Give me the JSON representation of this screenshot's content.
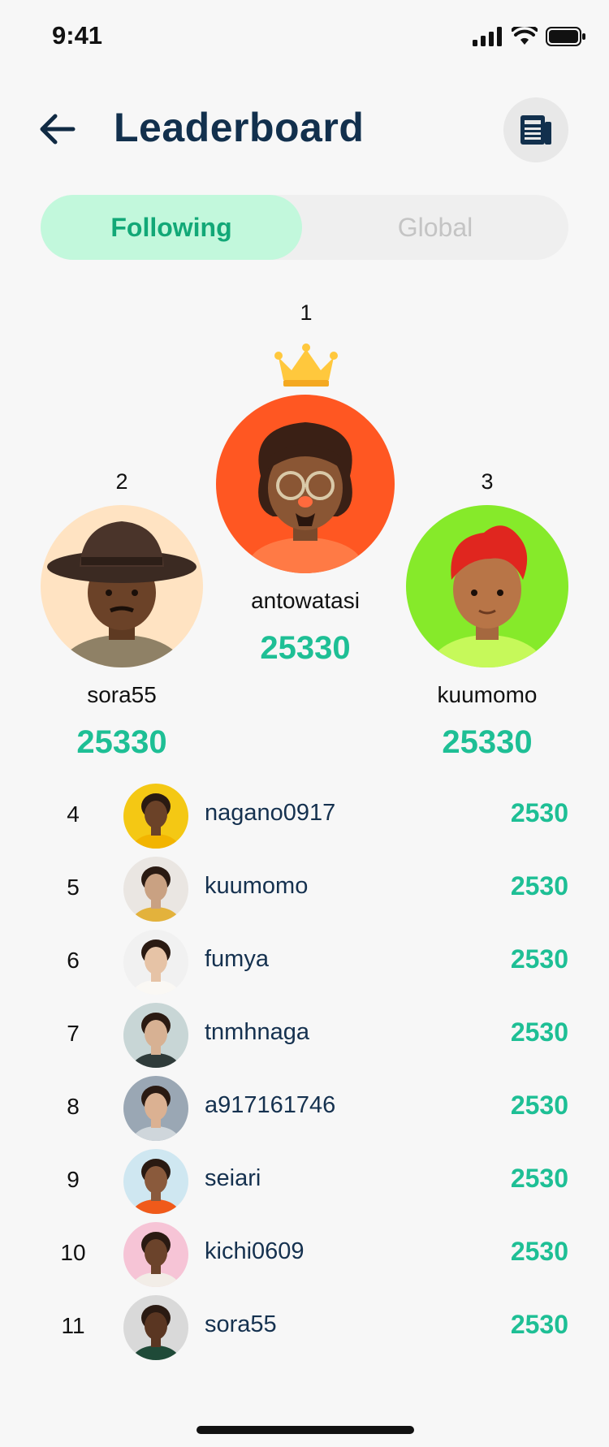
{
  "status_bar": {
    "time": "9:41"
  },
  "header": {
    "title": "Leaderboard"
  },
  "tabs": [
    {
      "label": "Following",
      "active": true
    },
    {
      "label": "Global",
      "active": false
    }
  ],
  "podium": {
    "first": {
      "rank": "1",
      "name": "antowatasi",
      "score": "25330",
      "bg": "#ff5722"
    },
    "second": {
      "rank": "2",
      "name": "sora55",
      "score": "25330",
      "bg": "#ffe3c2"
    },
    "third": {
      "rank": "3",
      "name": "kuumomo",
      "score": "25330",
      "bg": "#86ea2a"
    }
  },
  "list": [
    {
      "rank": "4",
      "name": "nagano0917",
      "score": "2530",
      "bg": "#f4c814",
      "skin": "#6b4228",
      "shirt": "#f2b400"
    },
    {
      "rank": "5",
      "name": "kuumomo",
      "score": "2530",
      "bg": "#eae6e2",
      "skin": "#c9a182",
      "shirt": "#e3b23c"
    },
    {
      "rank": "6",
      "name": "fumya",
      "score": "2530",
      "bg": "#f1f1f1",
      "skin": "#e6c3a6",
      "shirt": "#faf8f4"
    },
    {
      "rank": "7",
      "name": "tnmhnaga",
      "score": "2530",
      "bg": "#c8d6d6",
      "skin": "#d7b193",
      "shirt": "#2f3b3a"
    },
    {
      "rank": "8",
      "name": "a917161746",
      "score": "2530",
      "bg": "#9aa7b4",
      "skin": "#dbb192",
      "shirt": "#cfd6db"
    },
    {
      "rank": "9",
      "name": "seiari",
      "score": "2530",
      "bg": "#cfe7f1",
      "skin": "#8a5a3c",
      "shirt": "#f05a1a"
    },
    {
      "rank": "10",
      "name": "kichi0609",
      "score": "2530",
      "bg": "#f6c4d6",
      "skin": "#6b432b",
      "shirt": "#f2ede7"
    },
    {
      "rank": "11",
      "name": "sora55",
      "score": "2530",
      "bg": "#d9d9d9",
      "skin": "#5a3622",
      "shirt": "#1f4a38"
    }
  ]
}
